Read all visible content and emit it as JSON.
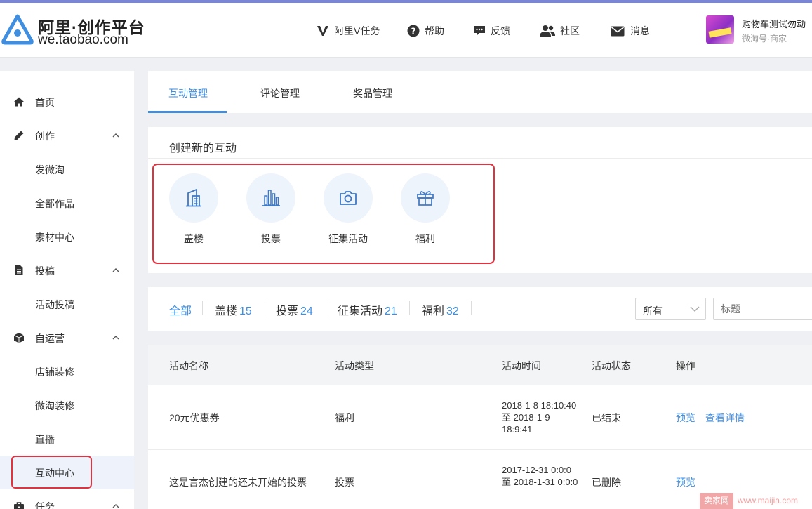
{
  "header": {
    "brand_title": "阿里·创作平台",
    "brand_sub": "we.taobao.com",
    "nav": [
      {
        "label": "阿里V任务",
        "icon": "v-task-icon"
      },
      {
        "label": "帮助",
        "icon": "help-icon"
      },
      {
        "label": "反馈",
        "icon": "feedback-icon"
      },
      {
        "label": "社区",
        "icon": "community-icon"
      },
      {
        "label": "消息",
        "icon": "message-icon"
      }
    ],
    "user": {
      "name": "购物车测试勿动",
      "sub": "微淘号·商家"
    }
  },
  "sidebar": {
    "items": [
      {
        "label": "首页",
        "icon": "home-icon"
      },
      {
        "label": "创作",
        "icon": "pencil-icon"
      },
      {
        "label": "发微淘"
      },
      {
        "label": "全部作品"
      },
      {
        "label": "素材中心"
      },
      {
        "label": "投稿",
        "icon": "document-icon"
      },
      {
        "label": "活动投稿"
      },
      {
        "label": "自运营",
        "icon": "box-icon"
      },
      {
        "label": "店铺装修"
      },
      {
        "label": "微淘装修"
      },
      {
        "label": "直播"
      },
      {
        "label": "互动中心"
      },
      {
        "label": "任务",
        "icon": "briefcase-icon"
      }
    ],
    "active_item": "互动中心"
  },
  "tabs": [
    {
      "label": "互动管理"
    },
    {
      "label": "评论管理"
    },
    {
      "label": "奖品管理"
    }
  ],
  "create": {
    "title": "创建新的互动",
    "types": [
      {
        "label": "盖楼",
        "icon": "building-icon"
      },
      {
        "label": "投票",
        "icon": "bar-chart-icon"
      },
      {
        "label": "征集活动",
        "icon": "camera-icon"
      },
      {
        "label": "福利",
        "icon": "gift-icon"
      }
    ]
  },
  "filters": [
    {
      "label": "全部",
      "count": ""
    },
    {
      "label": "盖楼",
      "count": "15"
    },
    {
      "label": "投票",
      "count": "24"
    },
    {
      "label": "征集活动",
      "count": "21"
    },
    {
      "label": "福利",
      "count": "32"
    }
  ],
  "status_select": {
    "value": "所有"
  },
  "title_search": {
    "placeholder": "标题"
  },
  "table": {
    "headers": [
      "活动名称",
      "活动类型",
      "活动时间",
      "活动状态",
      "操作"
    ],
    "rows": [
      {
        "name": "20元优惠券",
        "type": "福利",
        "time": "2018-1-8 18:10:40 至 2018-1-9 18:9:41",
        "status": "已结束",
        "actions": [
          "预览",
          "查看详情"
        ]
      },
      {
        "name": "这是言杰创建的还未开始的投票",
        "type": "投票",
        "time": "2017-12-31 0:0:0 至 2018-1-31 0:0:0",
        "status": "已删除",
        "actions": [
          "预览"
        ]
      }
    ]
  },
  "watermark": {
    "badge": "卖家网",
    "url": "www.maijia.com"
  },
  "colors": {
    "accent": "#3f8ee0",
    "highlight": "#e0333f",
    "top_bar": "#7b85d6"
  }
}
